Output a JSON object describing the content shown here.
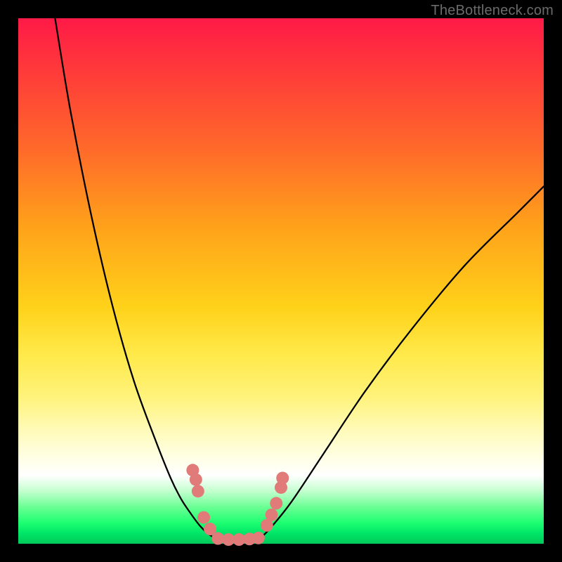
{
  "watermark": "TheBottleneck.com",
  "colors": {
    "frame_bg_top": "#ff1a47",
    "frame_bg_bottom": "#00c95a",
    "curve": "#000000",
    "marker": "#e07b7a",
    "page_bg": "#000000",
    "watermark": "#6b6b6b"
  },
  "chart_data": {
    "type": "line",
    "title": "",
    "xlabel": "",
    "ylabel": "",
    "xlim": [
      0,
      100
    ],
    "ylim": [
      0,
      100
    ],
    "grid": false,
    "legend": false,
    "series": [
      {
        "name": "left-branch",
        "x": [
          7,
          10,
          14,
          18,
          22,
          26,
          29,
          31,
          33,
          34.5,
          36,
          37.5
        ],
        "y": [
          100,
          82,
          62,
          45,
          31,
          20,
          12.5,
          8.5,
          5.5,
          3.5,
          2,
          1
        ]
      },
      {
        "name": "floor",
        "x": [
          37.5,
          40,
          43,
          46
        ],
        "y": [
          1,
          0.7,
          0.7,
          1
        ]
      },
      {
        "name": "right-branch",
        "x": [
          46,
          48,
          52,
          58,
          66,
          75,
          85,
          95,
          100
        ],
        "y": [
          1,
          3,
          8,
          17,
          29,
          41,
          53,
          63,
          68
        ]
      }
    ],
    "markers": [
      {
        "name": "left-cluster-a",
        "x": 33.2,
        "y": 14.0
      },
      {
        "name": "left-cluster-b",
        "x": 33.8,
        "y": 12.2
      },
      {
        "name": "left-cluster-c",
        "x": 34.2,
        "y": 10.0
      },
      {
        "name": "left-cluster-d",
        "x": 35.3,
        "y": 5.0
      },
      {
        "name": "left-cluster-e",
        "x": 36.5,
        "y": 2.8
      },
      {
        "name": "floor-a",
        "x": 38.0,
        "y": 1.0
      },
      {
        "name": "floor-b",
        "x": 40.0,
        "y": 0.8
      },
      {
        "name": "floor-c",
        "x": 42.0,
        "y": 0.8
      },
      {
        "name": "floor-d",
        "x": 44.0,
        "y": 0.9
      },
      {
        "name": "floor-e",
        "x": 45.7,
        "y": 1.1
      },
      {
        "name": "right-cluster-a",
        "x": 47.3,
        "y": 3.5
      },
      {
        "name": "right-cluster-b",
        "x": 48.2,
        "y": 5.5
      },
      {
        "name": "right-cluster-c",
        "x": 49.1,
        "y": 7.7
      },
      {
        "name": "right-cluster-d",
        "x": 50.0,
        "y": 10.7
      },
      {
        "name": "right-cluster-e",
        "x": 50.3,
        "y": 12.5
      }
    ]
  }
}
